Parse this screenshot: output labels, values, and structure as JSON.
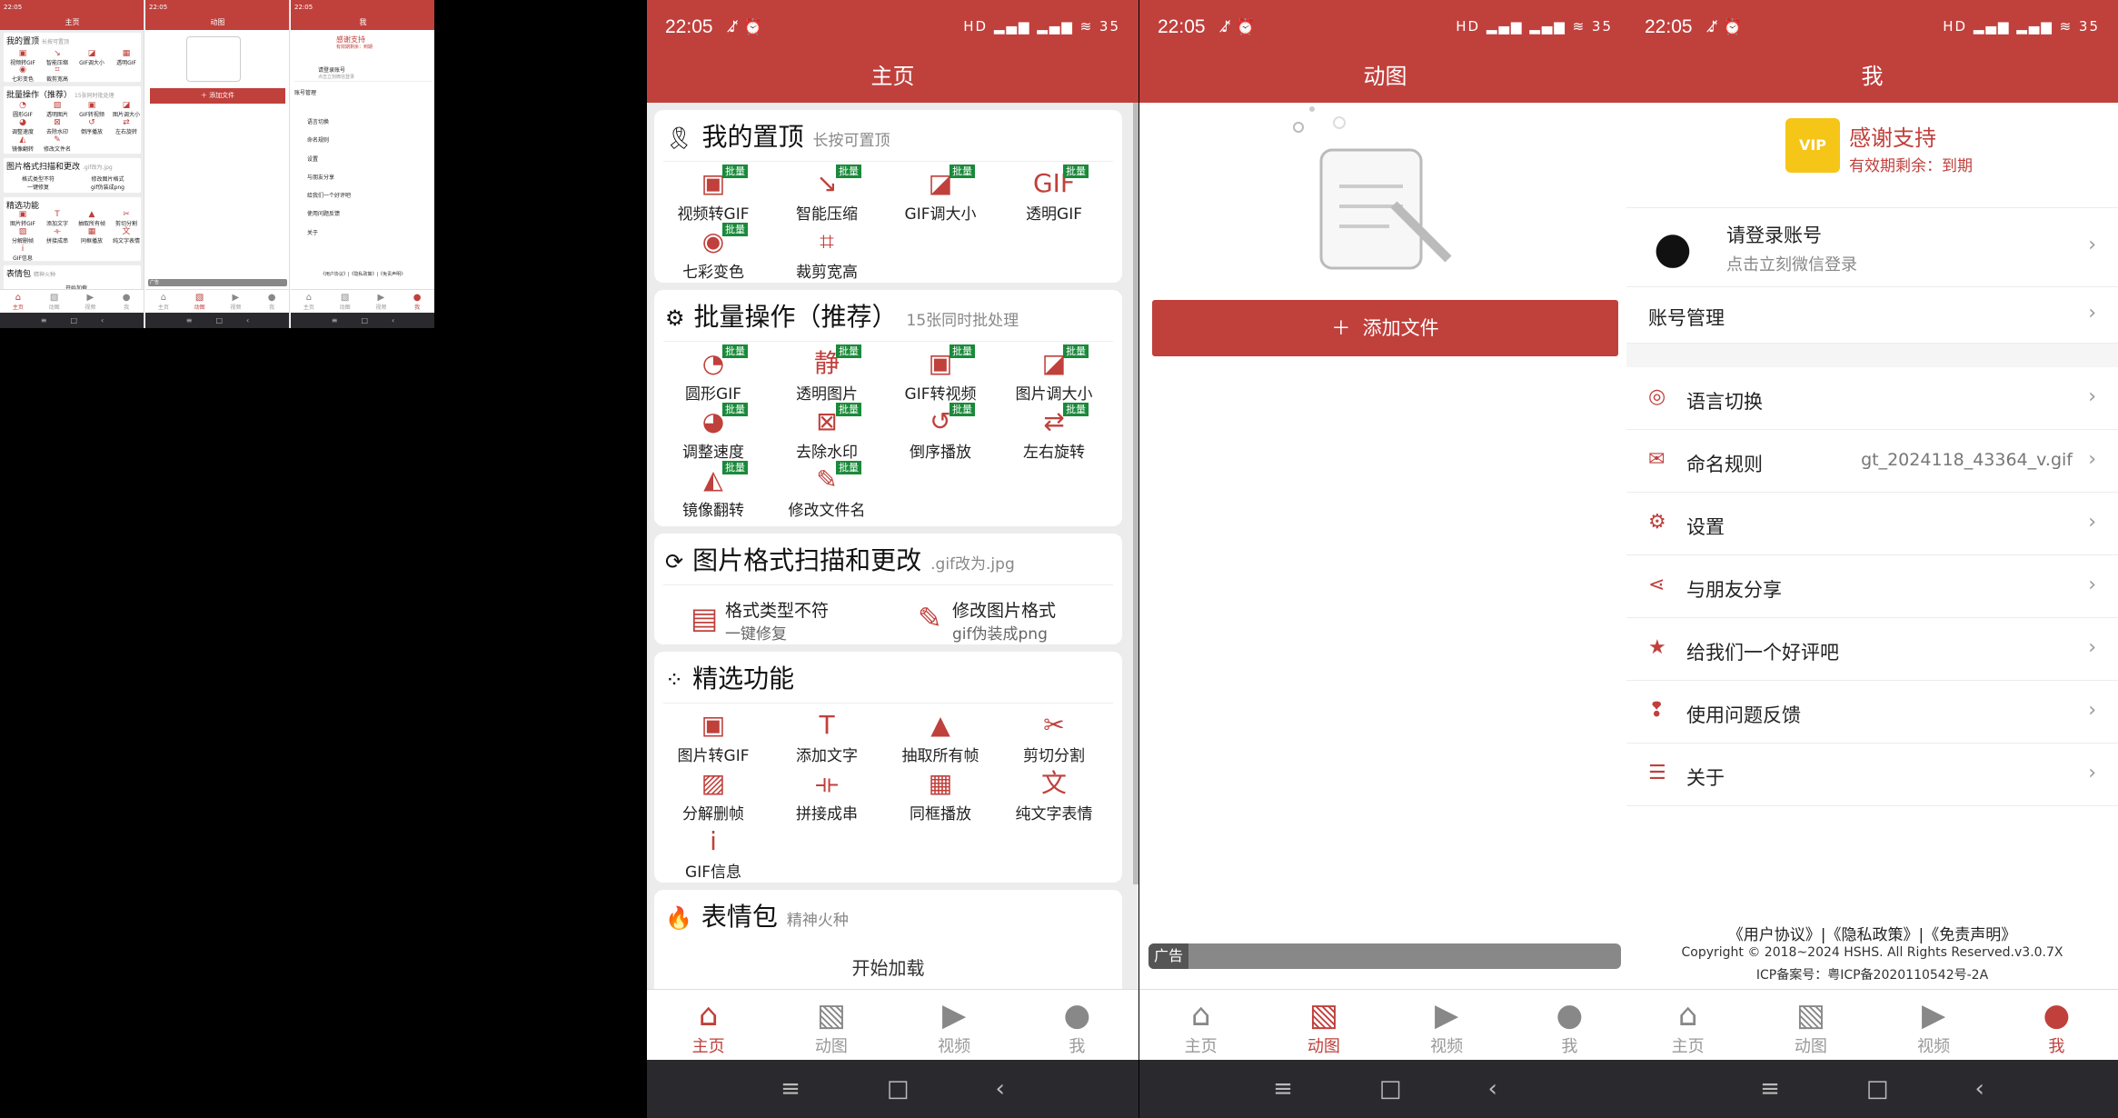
{
  "status": {
    "time": "22:05",
    "left_icons": "♪̸ ⏰",
    "right_icons": "HD ▂▄▆ ▂▄▆ ≋ 35"
  },
  "colors": {
    "brand": "#c0403c",
    "badge": "#1a8a3a"
  },
  "home": {
    "title": "主页",
    "pinned": {
      "title": "我的置顶",
      "hint": "长按可置顶",
      "items": [
        {
          "label": "视频转GIF",
          "icon": "gif-icon",
          "badge": "批量"
        },
        {
          "label": "智能压缩",
          "icon": "compress-icon",
          "badge": "批量"
        },
        {
          "label": "GIF调大小",
          "icon": "resize-icon",
          "badge": "批量"
        },
        {
          "label": "透明GIF",
          "icon": "transparent-gif-icon",
          "badge": "批量"
        },
        {
          "label": "七彩变色",
          "icon": "color-wheel-icon",
          "badge": "批量"
        },
        {
          "label": "裁剪宽高",
          "icon": "crop-icon",
          "badge": ""
        }
      ]
    },
    "batch": {
      "title": "批量操作（推荐）",
      "hint": "15张同时批处理",
      "items": [
        {
          "label": "圆形GIF",
          "badge": "批量"
        },
        {
          "label": "透明图片",
          "badge": "批量"
        },
        {
          "label": "GIF转视频",
          "badge": "批量"
        },
        {
          "label": "图片调大小",
          "badge": "批量"
        },
        {
          "label": "调整速度",
          "badge": "批量"
        },
        {
          "label": "去除水印",
          "badge": "批量"
        },
        {
          "label": "倒序播放",
          "badge": "批量"
        },
        {
          "label": "左右旋转",
          "badge": "批量"
        },
        {
          "label": "镜像翻转",
          "badge": "批量"
        },
        {
          "label": "修改文件名",
          "badge": "批量"
        }
      ]
    },
    "format": {
      "title": "图片格式扫描和更改",
      "hint": ".gif改为.jpg",
      "items": [
        {
          "title": "格式类型不符",
          "sub": "一键修复"
        },
        {
          "title": "修改图片格式",
          "sub": "gif伪装成png"
        }
      ]
    },
    "featured": {
      "title": "精选功能",
      "items": [
        {
          "label": "图片转GIF"
        },
        {
          "label": "添加文字"
        },
        {
          "label": "抽取所有帧"
        },
        {
          "label": "剪切分割"
        },
        {
          "label": "分解删帧"
        },
        {
          "label": "拼接成串"
        },
        {
          "label": "同框播放"
        },
        {
          "label": "纯文字表情"
        },
        {
          "label": "GIF信息"
        }
      ]
    },
    "emoji": {
      "title": "表情包",
      "hint": "精神火种",
      "loading": "开始加载"
    }
  },
  "nav": {
    "home": "主页",
    "dongtu": "动图",
    "video": "视频",
    "me": "我"
  },
  "dongtu": {
    "title": "动图",
    "add_file": "添加文件",
    "ad": "广告"
  },
  "me": {
    "title": "我",
    "vip_title": "感谢支持",
    "vip_sub": "有效期剩余：到期",
    "vip_badge": "VIP",
    "login_title": "请登录账号",
    "login_sub": "点击立刻微信登录",
    "account": "账号管理",
    "menu": [
      {
        "label": "语言切换",
        "value": "",
        "icon": "globe-icon"
      },
      {
        "label": "命名规则",
        "value": "gt_2024118_43364_v.gif",
        "icon": "inbox-icon"
      },
      {
        "label": "设置",
        "value": "",
        "icon": "gear-icon"
      },
      {
        "label": "与朋友分享",
        "value": "",
        "icon": "share-icon"
      },
      {
        "label": "给我们一个好评吧",
        "value": "",
        "icon": "star-icon"
      },
      {
        "label": "使用问题反馈",
        "value": "",
        "icon": "feedback-icon"
      },
      {
        "label": "关于",
        "value": "",
        "icon": "list-icon"
      }
    ],
    "legal": "《用户协议》|《隐私政策》|《免责声明》",
    "copyright": "Copyright © 2018~2024 HSHS. All Rights Reserved.v3.0.7X",
    "icp": "ICP备案号：粤ICP备2020110542号-2A"
  },
  "small": {
    "time": "22:05",
    "loading": "开始加载",
    "ad": "广告"
  }
}
